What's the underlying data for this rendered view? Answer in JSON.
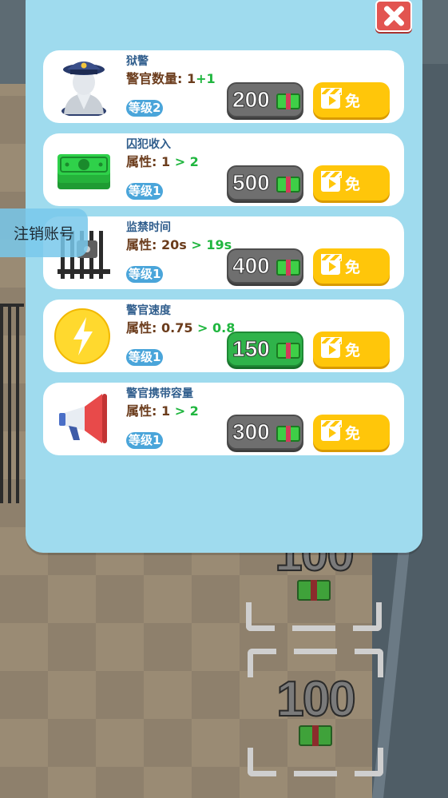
{
  "background": {
    "slots": [
      {
        "price": "100"
      },
      {
        "price": "100"
      }
    ]
  },
  "upgrades": [
    {
      "title": "狱警",
      "attr_label": "警官数量:",
      "attr_current": "1",
      "attr_next": "+1",
      "level": "等级2",
      "cost": "200",
      "cost_affordable": false,
      "free_label": "免",
      "icon": "police-officer-icon"
    },
    {
      "title": "囚犯收入",
      "attr_label": "属性:",
      "attr_current": "1",
      "attr_next": "> 2",
      "level": "等级1",
      "cost": "500",
      "cost_affordable": false,
      "free_label": "免",
      "icon": "cash-stack-icon"
    },
    {
      "title": "监禁时间",
      "attr_label": "属性:",
      "attr_current": "20s",
      "attr_next": "> 19s",
      "level": "等级1",
      "cost": "400",
      "cost_affordable": false,
      "free_label": "免",
      "icon": "prison-cell-icon"
    },
    {
      "title": "警官速度",
      "attr_label": "属性:",
      "attr_current": "0.75",
      "attr_next": "> 0.8",
      "level": "等级1",
      "cost": "150",
      "cost_affordable": true,
      "free_label": "免",
      "icon": "lightning-icon"
    },
    {
      "title": "警官携带容量",
      "attr_label": "属性:",
      "attr_current": "1",
      "attr_next": "> 2",
      "level": "等级1",
      "cost": "300",
      "cost_affordable": false,
      "free_label": "免",
      "icon": "megaphone-icon"
    }
  ],
  "floating_button": {
    "label": "注销账号"
  },
  "colors": {
    "panel": "#9fdbee",
    "accent_green": "#20b63f",
    "free_button": "#ffc60a",
    "close_button": "#e25450"
  }
}
